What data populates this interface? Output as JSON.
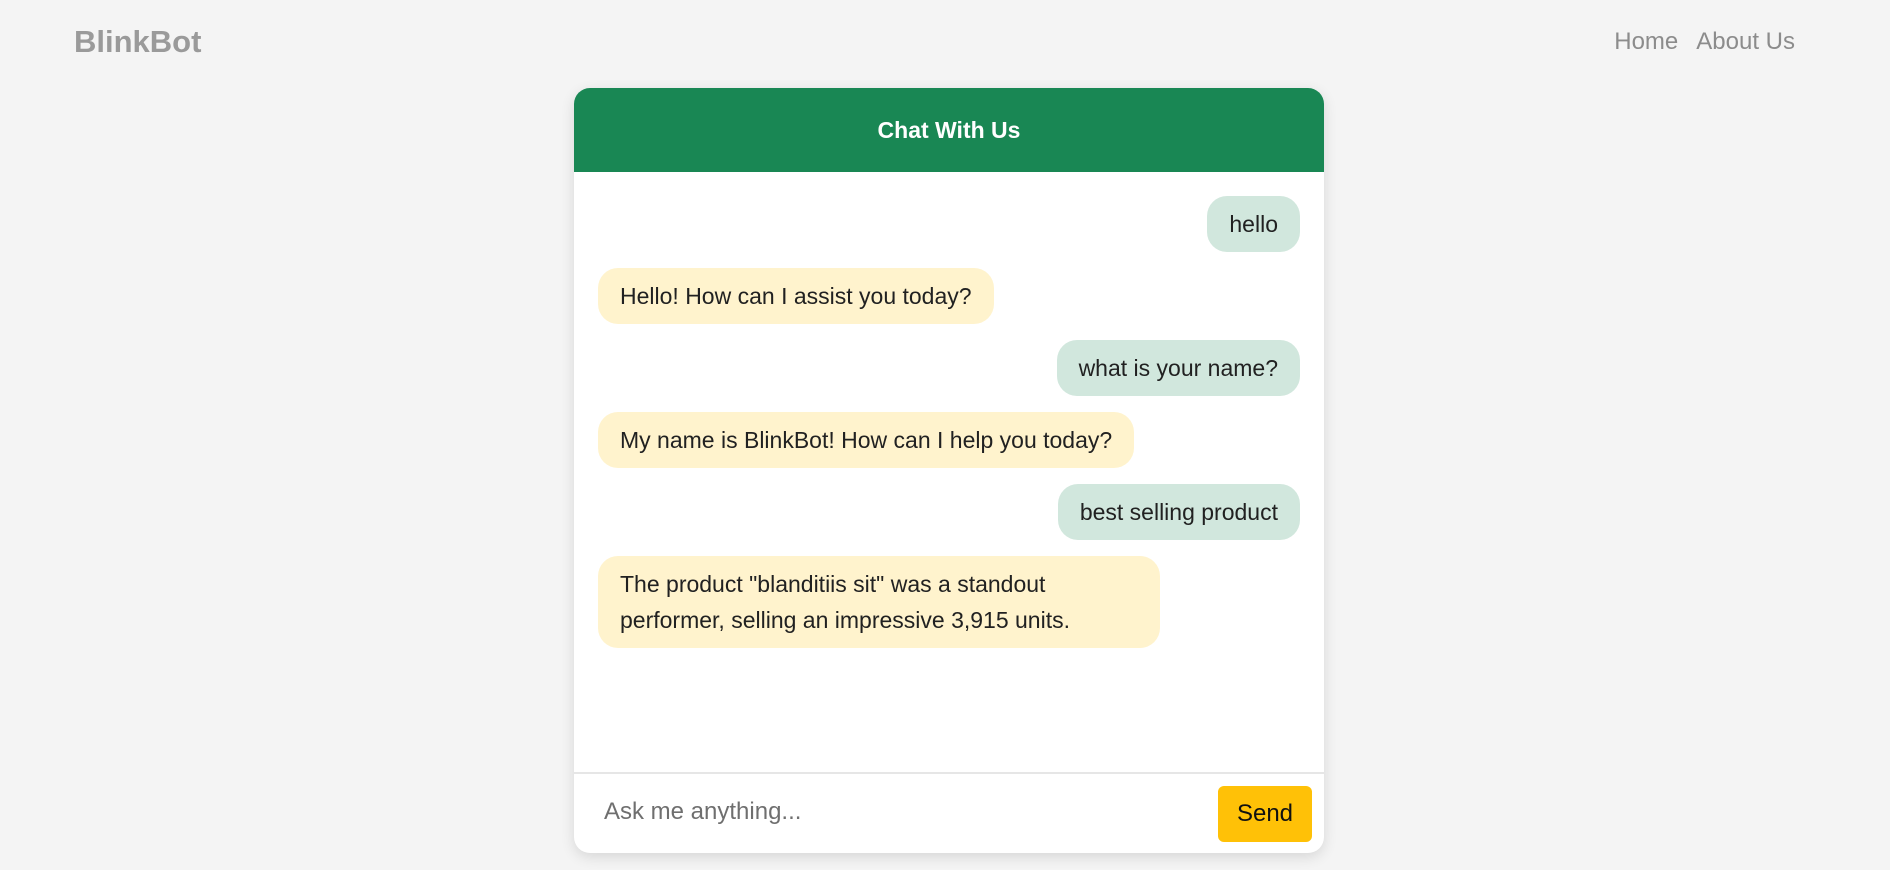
{
  "navbar": {
    "brand": "BlinkBot",
    "links": [
      "Home",
      "About Us"
    ]
  },
  "chat": {
    "title": "Chat With Us",
    "messages": [
      {
        "role": "user",
        "text": "hello"
      },
      {
        "role": "bot",
        "text": "Hello! How can I assist you today?"
      },
      {
        "role": "user",
        "text": "what is your name?"
      },
      {
        "role": "bot",
        "text": "My name is BlinkBot! How can I help you today?"
      },
      {
        "role": "user",
        "text": "best selling product"
      },
      {
        "role": "bot",
        "text": "The product \"blanditiis sit\" was a standout performer, selling an impressive 3,915 units."
      }
    ],
    "input": {
      "placeholder": "Ask me anything...",
      "value": ""
    },
    "send_label": "Send"
  },
  "colors": {
    "header": "#198754",
    "user_bubble": "#d1e7dd",
    "bot_bubble": "#fff3cd",
    "send_button": "#ffc107",
    "page_background": "#f4f4f4"
  }
}
